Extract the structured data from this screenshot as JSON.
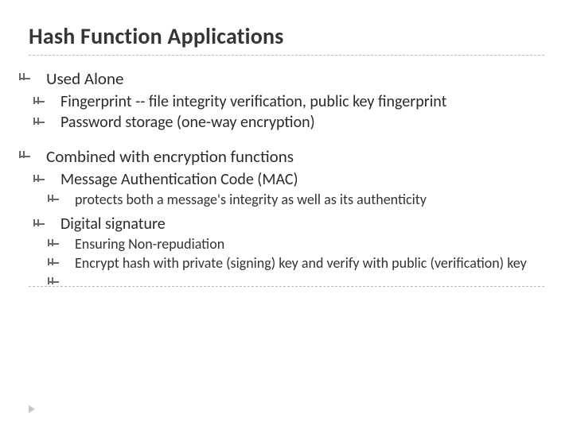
{
  "title": "Hash Function Applications",
  "sections": [
    {
      "heading": "Used Alone",
      "items": [
        {
          "text": "Fingerprint -- file integrity verification, public key fingerprint"
        },
        {
          "text": "Password storage (one-way encryption)"
        }
      ]
    },
    {
      "heading": "Combined with encryption functions",
      "items": [
        {
          "text": "Message Authentication Code (MAC)",
          "sub": [
            {
              "text": "protects both a message's integrity as well as its authenticity"
            }
          ]
        },
        {
          "text": "Digital signature",
          "sub": [
            {
              "text": "Ensuring Non-repudiation"
            },
            {
              "text": "Encrypt hash with private (signing) key and verify with public (verification) key"
            },
            {
              "text": ""
            }
          ]
        }
      ]
    }
  ]
}
